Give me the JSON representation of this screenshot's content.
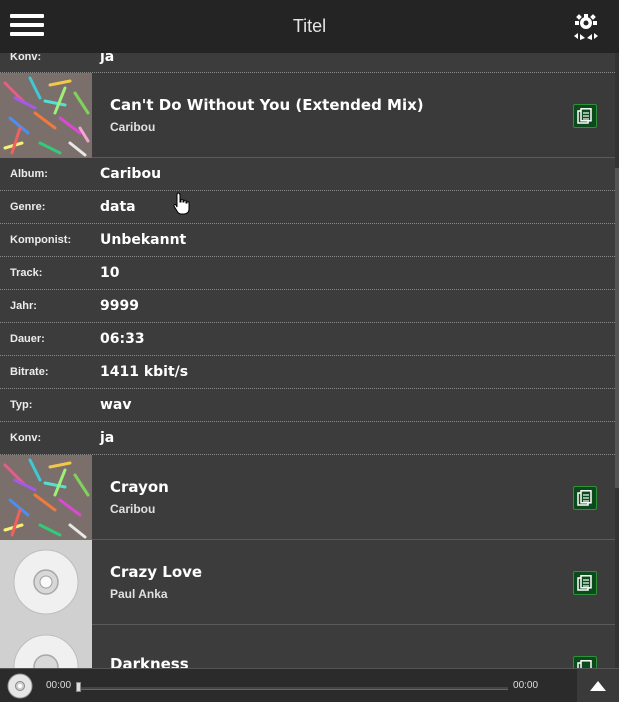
{
  "header": {
    "title": "Titel"
  },
  "top_partial": {
    "label": "Konv:",
    "value": "ja"
  },
  "selected_track": {
    "title": "Can't Do Without You (Extended Mix)",
    "artist": "Caribou"
  },
  "details": [
    {
      "label": "Album:",
      "value": "Caribou"
    },
    {
      "label": "Genre:",
      "value": "data"
    },
    {
      "label": "Komponist:",
      "value": "Unbekannt"
    },
    {
      "label": "Track:",
      "value": "10"
    },
    {
      "label": "Jahr:",
      "value": "9999"
    },
    {
      "label": "Dauer:",
      "value": "06:33"
    },
    {
      "label": "Bitrate:",
      "value": "1411 kbit/s"
    },
    {
      "label": "Typ:",
      "value": "wav"
    },
    {
      "label": "Konv:",
      "value": "ja"
    }
  ],
  "tracks": [
    {
      "title": "Crayon",
      "artist": "Caribou"
    },
    {
      "title": "Crazy Love",
      "artist": "Paul Anka"
    },
    {
      "title": "Darkness",
      "artist": ""
    }
  ],
  "player": {
    "current_time": "00:00",
    "total_time": "00:00",
    "progress": 0
  },
  "colors": {
    "queue_button": "#0b4a1a",
    "header_bg": "#242424",
    "list_bg": "#3c3c3c"
  },
  "icons": {
    "menu": "hamburger-icon",
    "settings": "gear-icon",
    "queue": "queue-icon",
    "up": "triangle-up-icon"
  }
}
